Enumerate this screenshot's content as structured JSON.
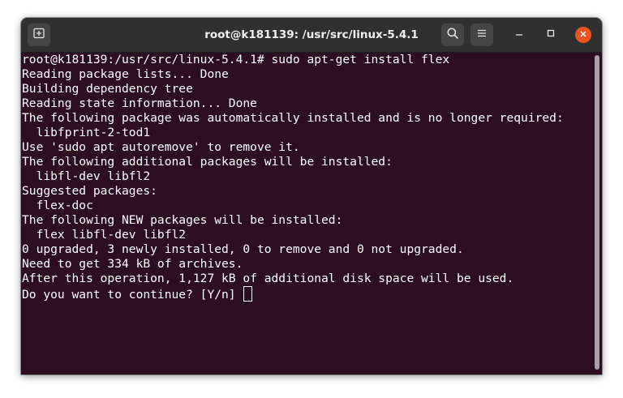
{
  "window": {
    "title": "root@k181139: /usr/src/linux-5.4.1"
  },
  "icons": {
    "new_tab": "new-tab-icon",
    "search": "search-icon",
    "menu": "hamburger-menu-icon",
    "minimize": "minimize-icon",
    "maximize": "maximize-icon",
    "close": "close-icon"
  },
  "colors": {
    "terminal_bg": "#2c0d22",
    "titlebar_bg": "#303030",
    "close_button": "#e95420",
    "text": "#ffffff"
  },
  "terminal": {
    "lines": [
      "root@k181139:/usr/src/linux-5.4.1# sudo apt-get install flex",
      "Reading package lists... Done",
      "Building dependency tree",
      "Reading state information... Done",
      "The following package was automatically installed and is no longer required:",
      "  libfprint-2-tod1",
      "Use 'sudo apt autoremove' to remove it.",
      "The following additional packages will be installed:",
      "  libfl-dev libfl2",
      "Suggested packages:",
      "  flex-doc",
      "The following NEW packages will be installed:",
      "  flex libfl-dev libfl2",
      "0 upgraded, 3 newly installed, 0 to remove and 0 not upgraded.",
      "Need to get 334 kB of archives.",
      "After this operation, 1,127 kB of additional disk space will be used.",
      "Do you want to continue? [Y/n] "
    ]
  }
}
